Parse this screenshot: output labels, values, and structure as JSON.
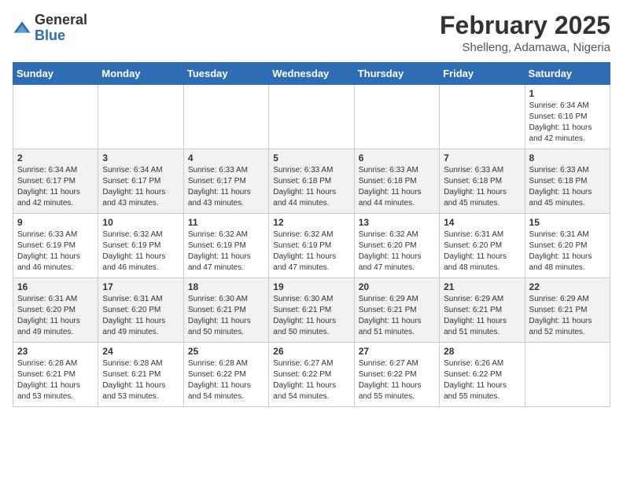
{
  "header": {
    "logo_general": "General",
    "logo_blue": "Blue",
    "month_title": "February 2025",
    "location": "Shelleng, Adamawa, Nigeria"
  },
  "days_of_week": [
    "Sunday",
    "Monday",
    "Tuesday",
    "Wednesday",
    "Thursday",
    "Friday",
    "Saturday"
  ],
  "weeks": [
    [
      {
        "day": "",
        "info": ""
      },
      {
        "day": "",
        "info": ""
      },
      {
        "day": "",
        "info": ""
      },
      {
        "day": "",
        "info": ""
      },
      {
        "day": "",
        "info": ""
      },
      {
        "day": "",
        "info": ""
      },
      {
        "day": "1",
        "info": "Sunrise: 6:34 AM\nSunset: 6:16 PM\nDaylight: 11 hours\nand 42 minutes."
      }
    ],
    [
      {
        "day": "2",
        "info": "Sunrise: 6:34 AM\nSunset: 6:17 PM\nDaylight: 11 hours\nand 42 minutes."
      },
      {
        "day": "3",
        "info": "Sunrise: 6:34 AM\nSunset: 6:17 PM\nDaylight: 11 hours\nand 43 minutes."
      },
      {
        "day": "4",
        "info": "Sunrise: 6:33 AM\nSunset: 6:17 PM\nDaylight: 11 hours\nand 43 minutes."
      },
      {
        "day": "5",
        "info": "Sunrise: 6:33 AM\nSunset: 6:18 PM\nDaylight: 11 hours\nand 44 minutes."
      },
      {
        "day": "6",
        "info": "Sunrise: 6:33 AM\nSunset: 6:18 PM\nDaylight: 11 hours\nand 44 minutes."
      },
      {
        "day": "7",
        "info": "Sunrise: 6:33 AM\nSunset: 6:18 PM\nDaylight: 11 hours\nand 45 minutes."
      },
      {
        "day": "8",
        "info": "Sunrise: 6:33 AM\nSunset: 6:18 PM\nDaylight: 11 hours\nand 45 minutes."
      }
    ],
    [
      {
        "day": "9",
        "info": "Sunrise: 6:33 AM\nSunset: 6:19 PM\nDaylight: 11 hours\nand 46 minutes."
      },
      {
        "day": "10",
        "info": "Sunrise: 6:32 AM\nSunset: 6:19 PM\nDaylight: 11 hours\nand 46 minutes."
      },
      {
        "day": "11",
        "info": "Sunrise: 6:32 AM\nSunset: 6:19 PM\nDaylight: 11 hours\nand 47 minutes."
      },
      {
        "day": "12",
        "info": "Sunrise: 6:32 AM\nSunset: 6:19 PM\nDaylight: 11 hours\nand 47 minutes."
      },
      {
        "day": "13",
        "info": "Sunrise: 6:32 AM\nSunset: 6:20 PM\nDaylight: 11 hours\nand 47 minutes."
      },
      {
        "day": "14",
        "info": "Sunrise: 6:31 AM\nSunset: 6:20 PM\nDaylight: 11 hours\nand 48 minutes."
      },
      {
        "day": "15",
        "info": "Sunrise: 6:31 AM\nSunset: 6:20 PM\nDaylight: 11 hours\nand 48 minutes."
      }
    ],
    [
      {
        "day": "16",
        "info": "Sunrise: 6:31 AM\nSunset: 6:20 PM\nDaylight: 11 hours\nand 49 minutes."
      },
      {
        "day": "17",
        "info": "Sunrise: 6:31 AM\nSunset: 6:20 PM\nDaylight: 11 hours\nand 49 minutes."
      },
      {
        "day": "18",
        "info": "Sunrise: 6:30 AM\nSunset: 6:21 PM\nDaylight: 11 hours\nand 50 minutes."
      },
      {
        "day": "19",
        "info": "Sunrise: 6:30 AM\nSunset: 6:21 PM\nDaylight: 11 hours\nand 50 minutes."
      },
      {
        "day": "20",
        "info": "Sunrise: 6:29 AM\nSunset: 6:21 PM\nDaylight: 11 hours\nand 51 minutes."
      },
      {
        "day": "21",
        "info": "Sunrise: 6:29 AM\nSunset: 6:21 PM\nDaylight: 11 hours\nand 51 minutes."
      },
      {
        "day": "22",
        "info": "Sunrise: 6:29 AM\nSunset: 6:21 PM\nDaylight: 11 hours\nand 52 minutes."
      }
    ],
    [
      {
        "day": "23",
        "info": "Sunrise: 6:28 AM\nSunset: 6:21 PM\nDaylight: 11 hours\nand 53 minutes."
      },
      {
        "day": "24",
        "info": "Sunrise: 6:28 AM\nSunset: 6:21 PM\nDaylight: 11 hours\nand 53 minutes."
      },
      {
        "day": "25",
        "info": "Sunrise: 6:28 AM\nSunset: 6:22 PM\nDaylight: 11 hours\nand 54 minutes."
      },
      {
        "day": "26",
        "info": "Sunrise: 6:27 AM\nSunset: 6:22 PM\nDaylight: 11 hours\nand 54 minutes."
      },
      {
        "day": "27",
        "info": "Sunrise: 6:27 AM\nSunset: 6:22 PM\nDaylight: 11 hours\nand 55 minutes."
      },
      {
        "day": "28",
        "info": "Sunrise: 6:26 AM\nSunset: 6:22 PM\nDaylight: 11 hours\nand 55 minutes."
      },
      {
        "day": "",
        "info": ""
      }
    ]
  ]
}
